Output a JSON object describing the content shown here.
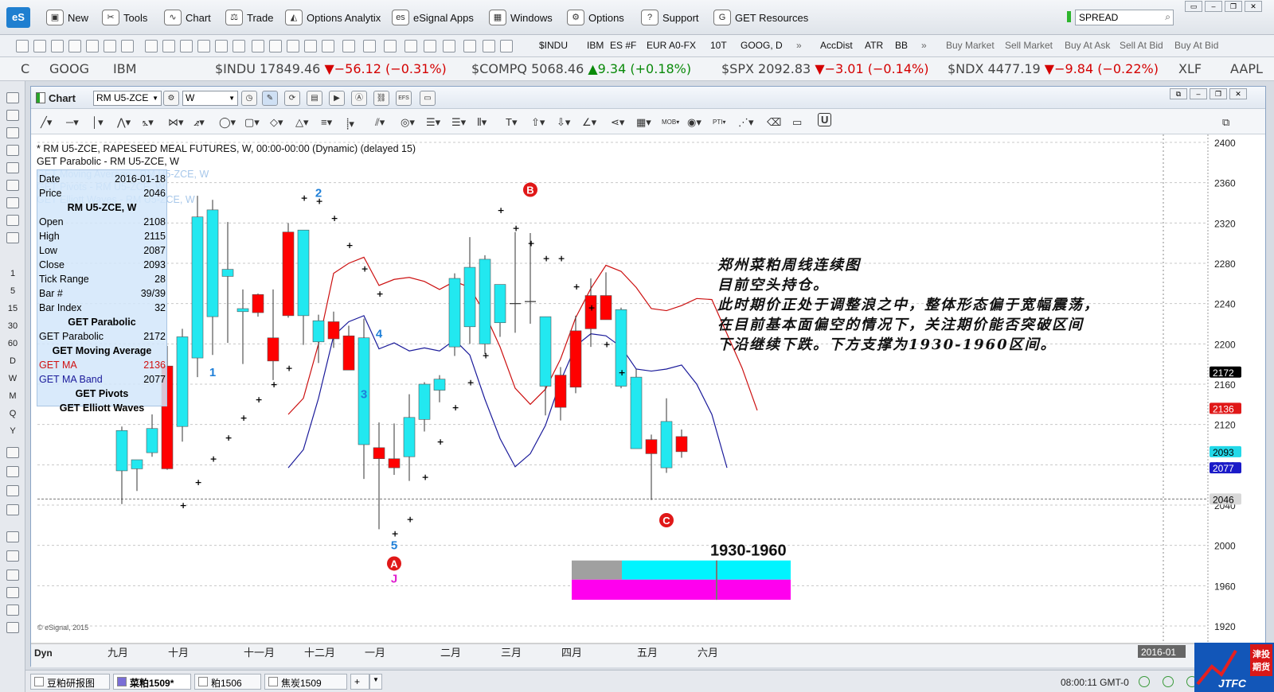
{
  "menubar": {
    "logo": "eS",
    "items": [
      {
        "label": "New",
        "icon": "new-window-icon"
      },
      {
        "label": "Tools",
        "icon": "tools-icon"
      },
      {
        "label": "Chart",
        "icon": "chart-icon"
      },
      {
        "label": "Trade",
        "icon": "trade-icon"
      },
      {
        "label": "Options Analytix",
        "icon": "options-analytix-icon"
      },
      {
        "label": "eSignal Apps",
        "icon": "esignal-apps-icon"
      },
      {
        "label": "Windows",
        "icon": "windows-icon"
      },
      {
        "label": "Options",
        "icon": "gear-icon"
      },
      {
        "label": "Support",
        "icon": "help-icon"
      },
      {
        "label": "GET Resources",
        "icon": "get-resources-icon"
      }
    ],
    "search_value": "SPREAD"
  },
  "toolbar2": {
    "symbols": [
      "$INDU",
      "IBM",
      "ES #F",
      "EUR A0-FX",
      "10T",
      "GOOG, D"
    ],
    "studies": [
      "AccDist",
      "ATR",
      "BB"
    ],
    "trade_buttons": [
      "Buy Market",
      "Sell Market",
      "Buy At Ask",
      "Sell At Bid",
      "Buy At Bid"
    ]
  },
  "ticker": [
    {
      "text": "C",
      "kind": "plain"
    },
    {
      "text": "GOOG",
      "kind": "plain"
    },
    {
      "text": "IBM",
      "kind": "plain"
    },
    {
      "sym": "$INDU",
      "price": "17849.46",
      "chg": "▼−56.12 (−0.31%)",
      "kind": "down"
    },
    {
      "sym": "$COMPQ",
      "price": "5068.46",
      "chg": "▲9.34 (+0.18%)",
      "kind": "up"
    },
    {
      "sym": "$SPX",
      "price": "2092.83",
      "chg": "▼−3.01 (−0.14%)",
      "kind": "down"
    },
    {
      "sym": "$NDX",
      "price": "4477.19",
      "chg": "▼−9.84 (−0.22%)",
      "kind": "down"
    },
    {
      "text": "XLF",
      "kind": "plain"
    },
    {
      "text": "AAPL",
      "kind": "plain"
    }
  ],
  "leftbar": {
    "intervals": [
      "1",
      "5",
      "15",
      "30",
      "60",
      "D",
      "W",
      "M",
      "Q",
      "Y"
    ]
  },
  "chartwin": {
    "title": "Chart",
    "symbol": "RM U5-ZCE",
    "interval": "W",
    "header_lines": [
      "* RM U5-ZCE, RAPESEED MEAL FUTURES, W, 00:00-00:00 (Dynamic) (delayed 15)",
      "GET Parabolic - RM U5-ZCE, W"
    ],
    "ghost_lines": [
      "GET Moving Average - RM U5-ZCE, W",
      "GET Pivots - RM U5-ZCE, W",
      "GET Elliott Waves - RM U5-ZCE, W"
    ],
    "data_window": {
      "date_label": "Date",
      "date": "2016-01-18",
      "price_label": "Price",
      "price": "2046",
      "symbol_head": "RM U5-ZCE, W",
      "rows": [
        {
          "k": "Open",
          "v": "2108"
        },
        {
          "k": "High",
          "v": "2115"
        },
        {
          "k": "Low",
          "v": "2087"
        },
        {
          "k": "Close",
          "v": "2093"
        },
        {
          "k": "Tick Range",
          "v": "28"
        },
        {
          "k": "Bar #",
          "v": "39/39"
        },
        {
          "k": "Bar Index",
          "v": "32"
        }
      ],
      "parabolic_head": "GET Parabolic",
      "parabolic": {
        "k": "GET Parabolic",
        "v": "2172"
      },
      "ma_head": "GET Moving Average",
      "ma": {
        "k": "GET MA",
        "v": "2136"
      },
      "ma_band": {
        "k": "GET MA Band",
        "v": "2077"
      },
      "pivots_head": "GET Pivots",
      "elliott_head": "GET Elliott Waves"
    },
    "annotation": [
      "郑州菜粕周线连续图",
      "目前空头持仓。",
      "此时期价正处于调整浪之中，整体形态偏于宽幅震荡，",
      "在目前基本面偏空的情况下，关注期价能否突破区间",
      "下沿继续下跌。下方支撑为1930-1960区间。"
    ],
    "watermark": "© eSignal, 2015"
  },
  "bottombar": {
    "tabs": [
      "豆粕研报图",
      "菜粕1509*",
      "粕1506",
      "焦炭1509"
    ],
    "active_tab": 1,
    "clock": "08:00:11 GMT-0",
    "logo_text": "JTFC",
    "logo_cn": "津投期货"
  },
  "chart_data": {
    "type": "candlestick",
    "symbol": "RM U5-ZCE",
    "ylim": [
      1920,
      2400
    ],
    "y_ticks": [
      1920,
      1960,
      2000,
      2040,
      2080,
      2120,
      2160,
      2200,
      2240,
      2280,
      2320,
      2360,
      2400
    ],
    "x_month_labels": [
      {
        "label": "九月",
        "bar": 0
      },
      {
        "label": "十月",
        "bar": 4
      },
      {
        "label": "十一月",
        "bar": 9
      },
      {
        "label": "十二月",
        "bar": 13
      },
      {
        "label": "一月",
        "bar": 17
      },
      {
        "label": "二月",
        "bar": 22
      },
      {
        "label": "三月",
        "bar": 26
      },
      {
        "label": "四月",
        "bar": 30
      },
      {
        "label": "五月",
        "bar": 35
      },
      {
        "label": "六月",
        "bar": 39
      }
    ],
    "x_axis_left": "Dyn",
    "x_axis_right": "2016-01",
    "candles": [
      {
        "o": 2074,
        "h": 2118,
        "l": 2041,
        "c": 2114
      },
      {
        "o": 2076,
        "h": 2085,
        "l": 2054,
        "c": 2085
      },
      {
        "o": 2092,
        "h": 2130,
        "l": 2088,
        "c": 2116
      },
      {
        "o": 2178,
        "h": 2198,
        "l": 2075,
        "c": 2076
      },
      {
        "o": 2118,
        "h": 2215,
        "l": 2103,
        "c": 2207
      },
      {
        "o": 2186,
        "h": 2347,
        "l": 2167,
        "c": 2326
      },
      {
        "o": 2227,
        "h": 2343,
        "l": 2189,
        "c": 2333
      },
      {
        "o": 2267,
        "h": 2321,
        "l": 2201,
        "c": 2274
      },
      {
        "o": 2232,
        "h": 2254,
        "l": 2180,
        "c": 2235
      },
      {
        "o": 2249,
        "h": 2250,
        "l": 2227,
        "c": 2231
      },
      {
        "o": 2206,
        "h": 2254,
        "l": 2164,
        "c": 2183
      },
      {
        "o": 2311,
        "h": 2320,
        "l": 2226,
        "c": 2228
      },
      {
        "o": 2228,
        "h": 2313,
        "l": 2199,
        "c": 2313
      },
      {
        "o": 2202,
        "h": 2229,
        "l": 2181,
        "c": 2223
      },
      {
        "o": 2222,
        "h": 2232,
        "l": 2196,
        "c": 2205
      },
      {
        "o": 2208,
        "h": 2218,
        "l": 2174,
        "c": 2174
      },
      {
        "o": 2100,
        "h": 2225,
        "l": 2066,
        "c": 2206
      },
      {
        "o": 2097,
        "h": 2122,
        "l": 2016,
        "c": 2086
      },
      {
        "o": 2086,
        "h": 2121,
        "l": 2070,
        "c": 2077
      },
      {
        "o": 2088,
        "h": 2150,
        "l": 2064,
        "c": 2127
      },
      {
        "o": 2125,
        "h": 2162,
        "l": 2113,
        "c": 2160
      },
      {
        "o": 2154,
        "h": 2169,
        "l": 2142,
        "c": 2165
      },
      {
        "o": 2197,
        "h": 2270,
        "l": 2188,
        "c": 2265
      },
      {
        "o": 2217,
        "h": 2306,
        "l": 2200,
        "c": 2276
      },
      {
        "o": 2200,
        "h": 2288,
        "l": 2190,
        "c": 2284
      },
      {
        "o": 2221,
        "h": 2259,
        "l": 2207,
        "c": 2259
      },
      {
        "o": 2240,
        "h": 2311,
        "l": 2211,
        "c": 2240
      },
      {
        "o": 2241,
        "h": 2310,
        "l": 2220,
        "c": 2242
      },
      {
        "o": 2158,
        "h": 2227,
        "l": 2129,
        "c": 2227
      },
      {
        "o": 2169,
        "h": 2177,
        "l": 2124,
        "c": 2137
      },
      {
        "o": 2213,
        "h": 2228,
        "l": 2151,
        "c": 2157
      },
      {
        "o": 2248,
        "h": 2265,
        "l": 2197,
        "c": 2215
      },
      {
        "o": 2248,
        "h": 2271,
        "l": 2224,
        "c": 2224
      },
      {
        "o": 2158,
        "h": 2236,
        "l": 2156,
        "c": 2234
      },
      {
        "o": 2096,
        "h": 2175,
        "l": 2097,
        "c": 2167
      },
      {
        "o": 2105,
        "h": 2110,
        "l": 2045,
        "c": 2091
      },
      {
        "o": 2077,
        "h": 2146,
        "l": 2072,
        "c": 2123
      },
      {
        "o": 2108,
        "h": 2115,
        "l": 2087,
        "c": 2093
      }
    ],
    "parabolic_dots": [
      {
        "bar": 4,
        "v": 2040
      },
      {
        "bar": 5,
        "v": 2063
      },
      {
        "bar": 6,
        "v": 2086
      },
      {
        "bar": 7,
        "v": 2107
      },
      {
        "bar": 8,
        "v": 2127
      },
      {
        "bar": 9,
        "v": 2145
      },
      {
        "bar": 10,
        "v": 2160
      },
      {
        "bar": 11,
        "v": 2176
      },
      {
        "bar": 12,
        "v": 2345
      },
      {
        "bar": 13,
        "v": 2342
      },
      {
        "bar": 14,
        "v": 2325
      },
      {
        "bar": 15,
        "v": 2298
      },
      {
        "bar": 16,
        "v": 2275
      },
      {
        "bar": 17,
        "v": 2250
      },
      {
        "bar": 18,
        "v": 2012
      },
      {
        "bar": 19,
        "v": 2026
      },
      {
        "bar": 20,
        "v": 2068
      },
      {
        "bar": 21,
        "v": 2103
      },
      {
        "bar": 22,
        "v": 2137
      },
      {
        "bar": 23,
        "v": 2162
      },
      {
        "bar": 24,
        "v": 2189
      },
      {
        "bar": 25,
        "v": 2333
      },
      {
        "bar": 26,
        "v": 2315
      },
      {
        "bar": 27,
        "v": 2300
      },
      {
        "bar": 28,
        "v": 2285
      },
      {
        "bar": 29,
        "v": 2285
      },
      {
        "bar": 30,
        "v": 2257
      },
      {
        "bar": 31,
        "v": 2236
      },
      {
        "bar": 32,
        "v": 2200
      },
      {
        "bar": 33,
        "v": 2172
      }
    ],
    "ma_line": [
      {
        "bar": 11,
        "v": 2130
      },
      {
        "bar": 12,
        "v": 2146
      },
      {
        "bar": 13,
        "v": 2200
      },
      {
        "bar": 14,
        "v": 2270
      },
      {
        "bar": 15,
        "v": 2280
      },
      {
        "bar": 16,
        "v": 2286
      },
      {
        "bar": 17,
        "v": 2258
      },
      {
        "bar": 18,
        "v": 2264
      },
      {
        "bar": 19,
        "v": 2266
      },
      {
        "bar": 20,
        "v": 2262
      },
      {
        "bar": 21,
        "v": 2254
      },
      {
        "bar": 22,
        "v": 2262
      },
      {
        "bar": 23,
        "v": 2256
      },
      {
        "bar": 24,
        "v": 2230
      },
      {
        "bar": 25,
        "v": 2197
      },
      {
        "bar": 26,
        "v": 2156
      },
      {
        "bar": 27,
        "v": 2140
      },
      {
        "bar": 28,
        "v": 2155
      },
      {
        "bar": 29,
        "v": 2185
      },
      {
        "bar": 30,
        "v": 2226
      },
      {
        "bar": 31,
        "v": 2255
      },
      {
        "bar": 32,
        "v": 2278
      },
      {
        "bar": 33,
        "v": 2272
      },
      {
        "bar": 34,
        "v": 2256
      },
      {
        "bar": 35,
        "v": 2235
      },
      {
        "bar": 36,
        "v": 2233
      },
      {
        "bar": 37,
        "v": 2238
      },
      {
        "bar": 38,
        "v": 2245
      },
      {
        "bar": 39,
        "v": 2244
      },
      {
        "bar": 40,
        "v": 2210
      },
      {
        "bar": 41,
        "v": 2176
      },
      {
        "bar": 42,
        "v": 2134
      }
    ],
    "ma_band_line": [
      {
        "bar": 11,
        "v": 2077
      },
      {
        "bar": 12,
        "v": 2095
      },
      {
        "bar": 13,
        "v": 2146
      },
      {
        "bar": 14,
        "v": 2208
      },
      {
        "bar": 15,
        "v": 2222
      },
      {
        "bar": 16,
        "v": 2228
      },
      {
        "bar": 17,
        "v": 2195
      },
      {
        "bar": 18,
        "v": 2201
      },
      {
        "bar": 19,
        "v": 2193
      },
      {
        "bar": 20,
        "v": 2196
      },
      {
        "bar": 21,
        "v": 2193
      },
      {
        "bar": 22,
        "v": 2204
      },
      {
        "bar": 23,
        "v": 2189
      },
      {
        "bar": 24,
        "v": 2145
      },
      {
        "bar": 25,
        "v": 2106
      },
      {
        "bar": 26,
        "v": 2078
      },
      {
        "bar": 27,
        "v": 2091
      },
      {
        "bar": 28,
        "v": 2119
      },
      {
        "bar": 29,
        "v": 2163
      },
      {
        "bar": 30,
        "v": 2198
      },
      {
        "bar": 31,
        "v": 2210
      },
      {
        "bar": 32,
        "v": 2208
      },
      {
        "bar": 33,
        "v": 2197
      },
      {
        "bar": 34,
        "v": 2175
      },
      {
        "bar": 35,
        "v": 2173
      },
      {
        "bar": 36,
        "v": 2175
      },
      {
        "bar": 37,
        "v": 2179
      },
      {
        "bar": 38,
        "v": 2160
      },
      {
        "bar": 39,
        "v": 2130
      },
      {
        "bar": 40,
        "v": 2077
      }
    ],
    "waves": [
      {
        "label": "1",
        "bar": 6,
        "v": 2172,
        "color": "#1e7fd8",
        "style": "text"
      },
      {
        "label": "2",
        "bar": 13,
        "v": 2350,
        "color": "#1e7fd8",
        "style": "text"
      },
      {
        "label": "3",
        "bar": 16,
        "v": 2150,
        "color": "#1e7fd8",
        "style": "text"
      },
      {
        "label": "4",
        "bar": 17,
        "v": 2210,
        "color": "#1e7fd8",
        "style": "text"
      },
      {
        "label": "5",
        "bar": 18,
        "v": 2000,
        "color": "#1e7fd8",
        "style": "text"
      },
      {
        "label": "A",
        "bar": 18,
        "v": 1982,
        "color": "#e01818",
        "style": "circle"
      },
      {
        "label": "J",
        "bar": 18,
        "v": 1967,
        "color": "#e01fd0",
        "style": "text"
      },
      {
        "label": "B",
        "bar": 27,
        "v": 2353,
        "color": "#e01818",
        "style": "circle"
      },
      {
        "label": "C",
        "bar": 36,
        "v": 2025,
        "color": "#e01818",
        "style": "circle"
      }
    ],
    "price_tags": [
      {
        "v": 2172,
        "label": "2172",
        "bg": "#000000",
        "fg": "#ffffff"
      },
      {
        "v": 2136,
        "label": "2136",
        "bg": "#e01818",
        "fg": "#ffffff"
      },
      {
        "v": 2093,
        "label": "2093",
        "bg": "#22d8e8",
        "fg": "#000000"
      },
      {
        "v": 2077,
        "label": "2077",
        "bg": "#1a1ac8",
        "fg": "#ffffff"
      },
      {
        "v": 2046,
        "label": "2046",
        "bg": "#d8d8d8",
        "fg": "#000000"
      }
    ],
    "crosshair_price": 2046,
    "support_zone": {
      "label": "1930-1960",
      "low": 1930,
      "high": 1960,
      "from_bar": 30,
      "to_bar": 44,
      "split_bar": 33,
      "mid_bar": 39
    },
    "colors": {
      "up": "#22e8f0",
      "down": "#ff0000",
      "ma": "#cc1010",
      "band": "#1a1a9a",
      "zone_cyan": "#00f4ff",
      "zone_magenta": "#ff00ee",
      "zone_grey": "#a0a0a0"
    }
  }
}
